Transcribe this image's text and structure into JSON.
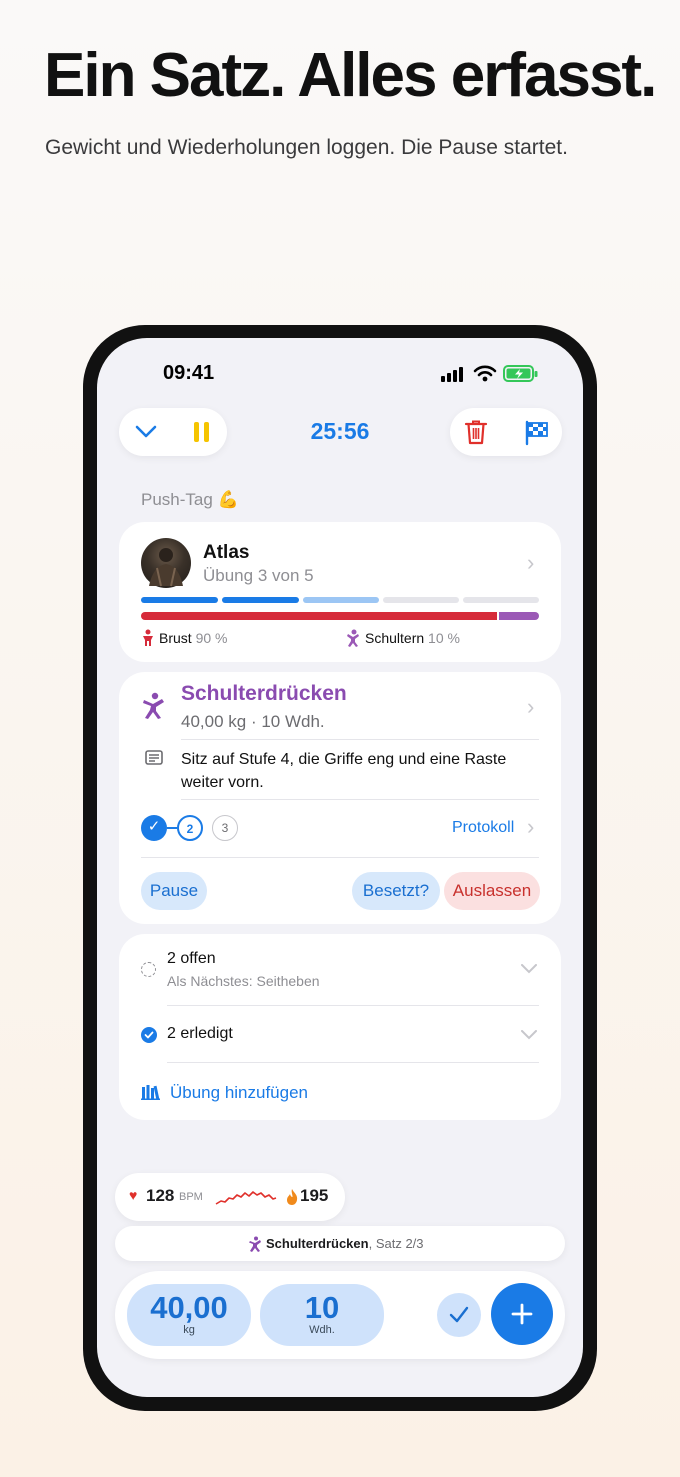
{
  "promo": {
    "headline": "Ein Satz. Alles erfasst.",
    "subline": "Gewicht und Wiederholungen loggen. Die Pause startet."
  },
  "status_bar": {
    "time": "09:41"
  },
  "toolbar": {
    "timer": "25:56",
    "colors": {
      "accent": "#1a7be6",
      "pause": "#f5c400",
      "trash": "#e0302b"
    }
  },
  "workout": {
    "name": "Push-Tag 💪"
  },
  "routine_card": {
    "title": "Atlas",
    "subtitle": "Übung 3 von 5",
    "progress_segments": [
      "done",
      "done",
      "current",
      "pending",
      "pending"
    ],
    "muscle_split": [
      {
        "name": "Brust",
        "pct": "90 %",
        "fraction": 0.9,
        "color": "#d62b3a"
      },
      {
        "name": "Schultern",
        "pct": "10 %",
        "fraction": 0.1,
        "color": "#9b59b6"
      }
    ]
  },
  "exercise_card": {
    "title": "Schulterdrücken",
    "detail": "40,00 kg · 10 Wdh.",
    "note": "Sitz auf Stufe 4, die Griffe eng und eine Raste weiter vorn.",
    "sets": [
      "✓",
      "2",
      "3"
    ],
    "protocol_label": "Protokoll",
    "buttons": {
      "pause": "Pause",
      "occupied": "Besetzt?",
      "skip": "Auslassen"
    }
  },
  "queue_card": {
    "open_label": "2 offen",
    "open_next": "Als Nächstes: Seitheben",
    "done_label": "2 erledigt",
    "add_label": "Übung hinzufügen"
  },
  "health": {
    "bpm": "128",
    "bpm_unit": "BPM",
    "calories": "195"
  },
  "current_set": {
    "exercise": "Schulterdrücken",
    "set_text": ", Satz 2/3"
  },
  "input_bar": {
    "weight": "40,00",
    "weight_unit": "kg",
    "reps": "10",
    "reps_unit": "Wdh."
  }
}
